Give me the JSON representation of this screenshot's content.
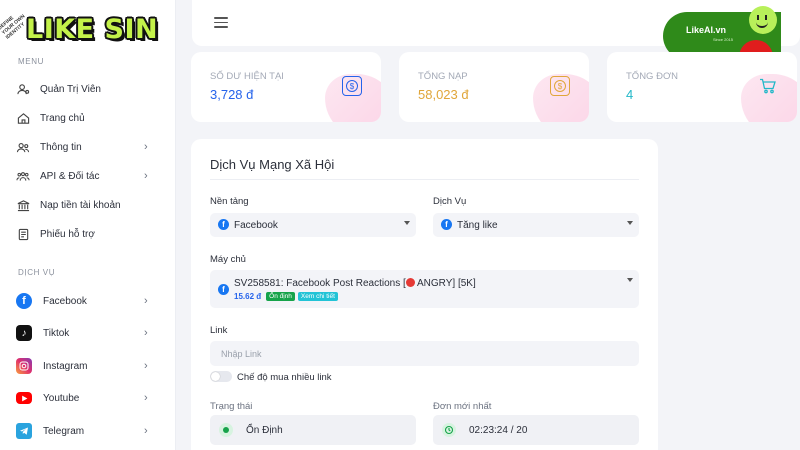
{
  "brand": {
    "name": "LIKE SIN",
    "tagline": "DEFINE YOUR OWN IDENTITY"
  },
  "sidebar": {
    "menu_label": "MENU",
    "menu_items": [
      {
        "label": "Quản Trị Viên",
        "icon": "user-admin-icon",
        "has_chevron": false
      },
      {
        "label": "Trang chủ",
        "icon": "home-icon",
        "has_chevron": false
      },
      {
        "label": "Thông tin",
        "icon": "users-icon",
        "has_chevron": true
      },
      {
        "label": "API & Đối tác",
        "icon": "partners-icon",
        "has_chevron": true
      },
      {
        "label": "Nạp tiền tài khoản",
        "icon": "bank-icon",
        "has_chevron": false
      },
      {
        "label": "Phiếu hỗ trợ",
        "icon": "ticket-icon",
        "has_chevron": false
      }
    ],
    "services_label": "DỊCH VỤ",
    "services": [
      {
        "label": "Facebook",
        "icon": "facebook-icon",
        "color": "#1877f2"
      },
      {
        "label": "Tiktok",
        "icon": "tiktok-icon",
        "color": "#111111"
      },
      {
        "label": "Instagram",
        "icon": "instagram-icon",
        "color": "#e1306c"
      },
      {
        "label": "Youtube",
        "icon": "youtube-icon",
        "color": "#ff0000"
      },
      {
        "label": "Telegram",
        "icon": "telegram-icon",
        "color": "#2aa3de"
      }
    ]
  },
  "header": {
    "badge_title": "LikeAI.vn",
    "badge_sub": "Since 2015"
  },
  "stats": [
    {
      "title": "SỐ DƯ HIỆN TẠI",
      "value": "3,728 đ",
      "color": "#2563eb",
      "icon": "dollar-icon"
    },
    {
      "title": "TỔNG NẠP",
      "value": "58,023 đ",
      "color": "#e0a63a",
      "icon": "dollar-icon"
    },
    {
      "title": "TỔNG ĐƠN",
      "value": "4",
      "color": "#22b8c8",
      "icon": "cart-icon"
    }
  ],
  "form": {
    "title": "Dịch Vụ Mạng Xã Hội",
    "platform_label": "Nền tảng",
    "platform_value": "Facebook",
    "service_label": "Dịch Vụ",
    "service_value": "Tăng like",
    "server_label": "Máy chủ",
    "server_value": "SV258581: Facebook Post Reactions [",
    "server_value_tail": " ANGRY] [5K]",
    "server_price": "15.62 đ",
    "server_badge_status": "Ổn định",
    "server_badge_detail": "Xem chi tiết",
    "link_label": "Link",
    "link_placeholder": "Nhập Link",
    "multi_link_label": "Chế độ mua nhiều link",
    "state_label": "Trạng thái",
    "state_value": "Ổn Định",
    "new_order_label": "Đơn mới nhất",
    "new_order_value": "02:23:24 / 20"
  }
}
